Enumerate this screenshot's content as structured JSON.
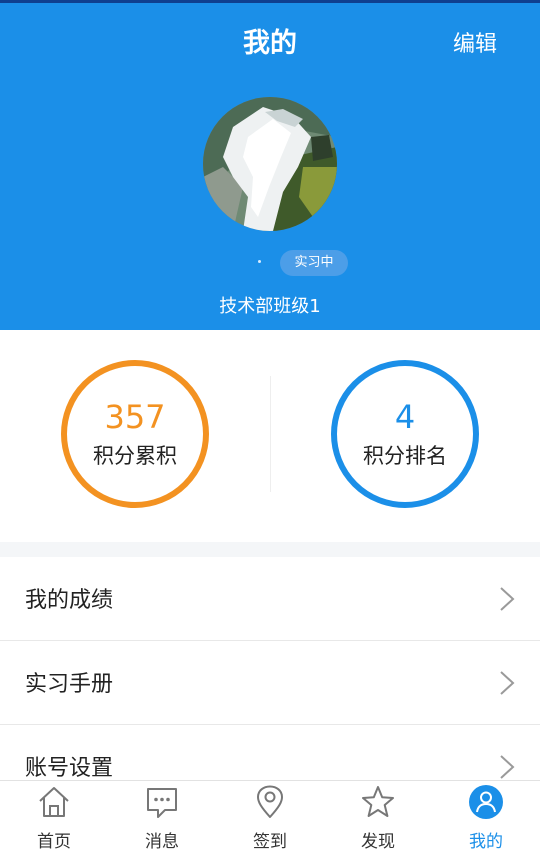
{
  "header": {
    "title": "我的",
    "edit_label": "编辑",
    "status_badge": "实习中",
    "class_name": "技术部班级1"
  },
  "stats": {
    "points_value": "357",
    "points_label": "积分累积",
    "rank_value": "4",
    "rank_label": "积分排名"
  },
  "menu": [
    {
      "label": "我的成绩",
      "icon": "chevron-right-icon"
    },
    {
      "label": "实习手册",
      "icon": "chevron-right-icon"
    },
    {
      "label": "账号设置",
      "icon": "chevron-right-icon"
    }
  ],
  "tabbar": [
    {
      "label": "首页",
      "icon": "home-icon"
    },
    {
      "label": "消息",
      "icon": "message-icon"
    },
    {
      "label": "签到",
      "icon": "location-pin-icon"
    },
    {
      "label": "发现",
      "icon": "star-icon"
    },
    {
      "label": "我的",
      "icon": "user-icon",
      "active": true
    }
  ],
  "colors": {
    "primary": "#1b8fe8",
    "points_accent": "#f39221",
    "background": "#f4f6f8"
  }
}
